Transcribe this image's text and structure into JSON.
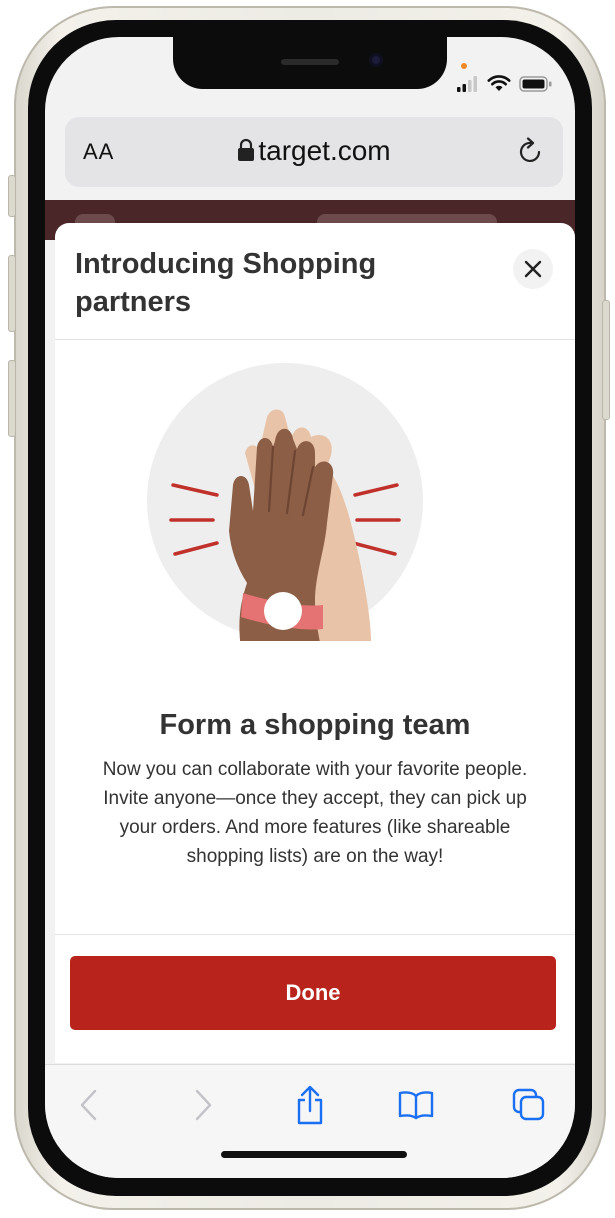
{
  "address_bar": {
    "text_size_label": "AA",
    "host": "target.com"
  },
  "modal": {
    "title": "Introducing Shopping partners",
    "heading": "Form a shopping team",
    "body": "Now you can collaborate with your favorite people. Invite anyone—once they accept, they can pick up your orders. And more features (like shareable shopping lists) are on the way!",
    "done_label": "Done"
  },
  "colors": {
    "accent": "#b8241c",
    "browser_chrome": "#e4e4e6",
    "page_header": "#4a2628"
  },
  "icons": {
    "close": "close-icon",
    "lock": "lock-icon",
    "reload": "reload-icon",
    "back": "back-icon",
    "forward": "forward-icon",
    "share": "share-icon",
    "bookmarks": "bookmarks-icon",
    "tabs": "tabs-icon"
  }
}
